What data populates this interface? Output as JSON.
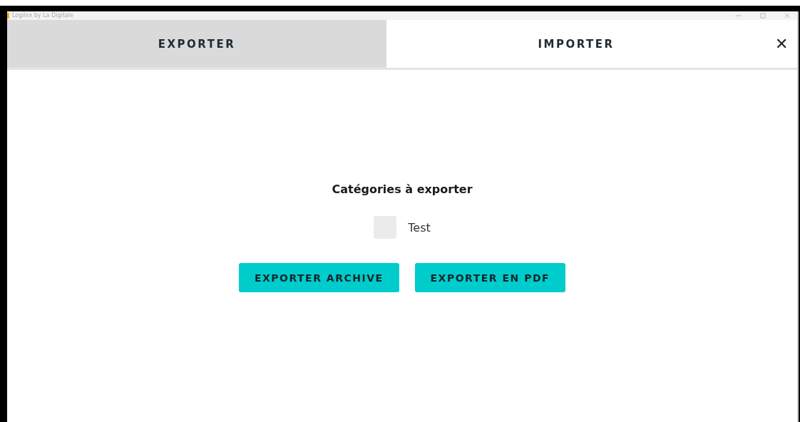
{
  "window": {
    "title": "Logilex by La Digitale"
  },
  "tabs": [
    {
      "label": "EXPORTER",
      "selected": true
    },
    {
      "label": "IMPORTER",
      "selected": false
    }
  ],
  "close": {
    "label": "✕"
  },
  "export": {
    "heading": "Catégories à exporter",
    "categories": [
      {
        "label": "Test",
        "checked": false
      }
    ],
    "buttons": [
      "EXPORTER ARCHIVE",
      "EXPORTER EN PDF"
    ]
  }
}
